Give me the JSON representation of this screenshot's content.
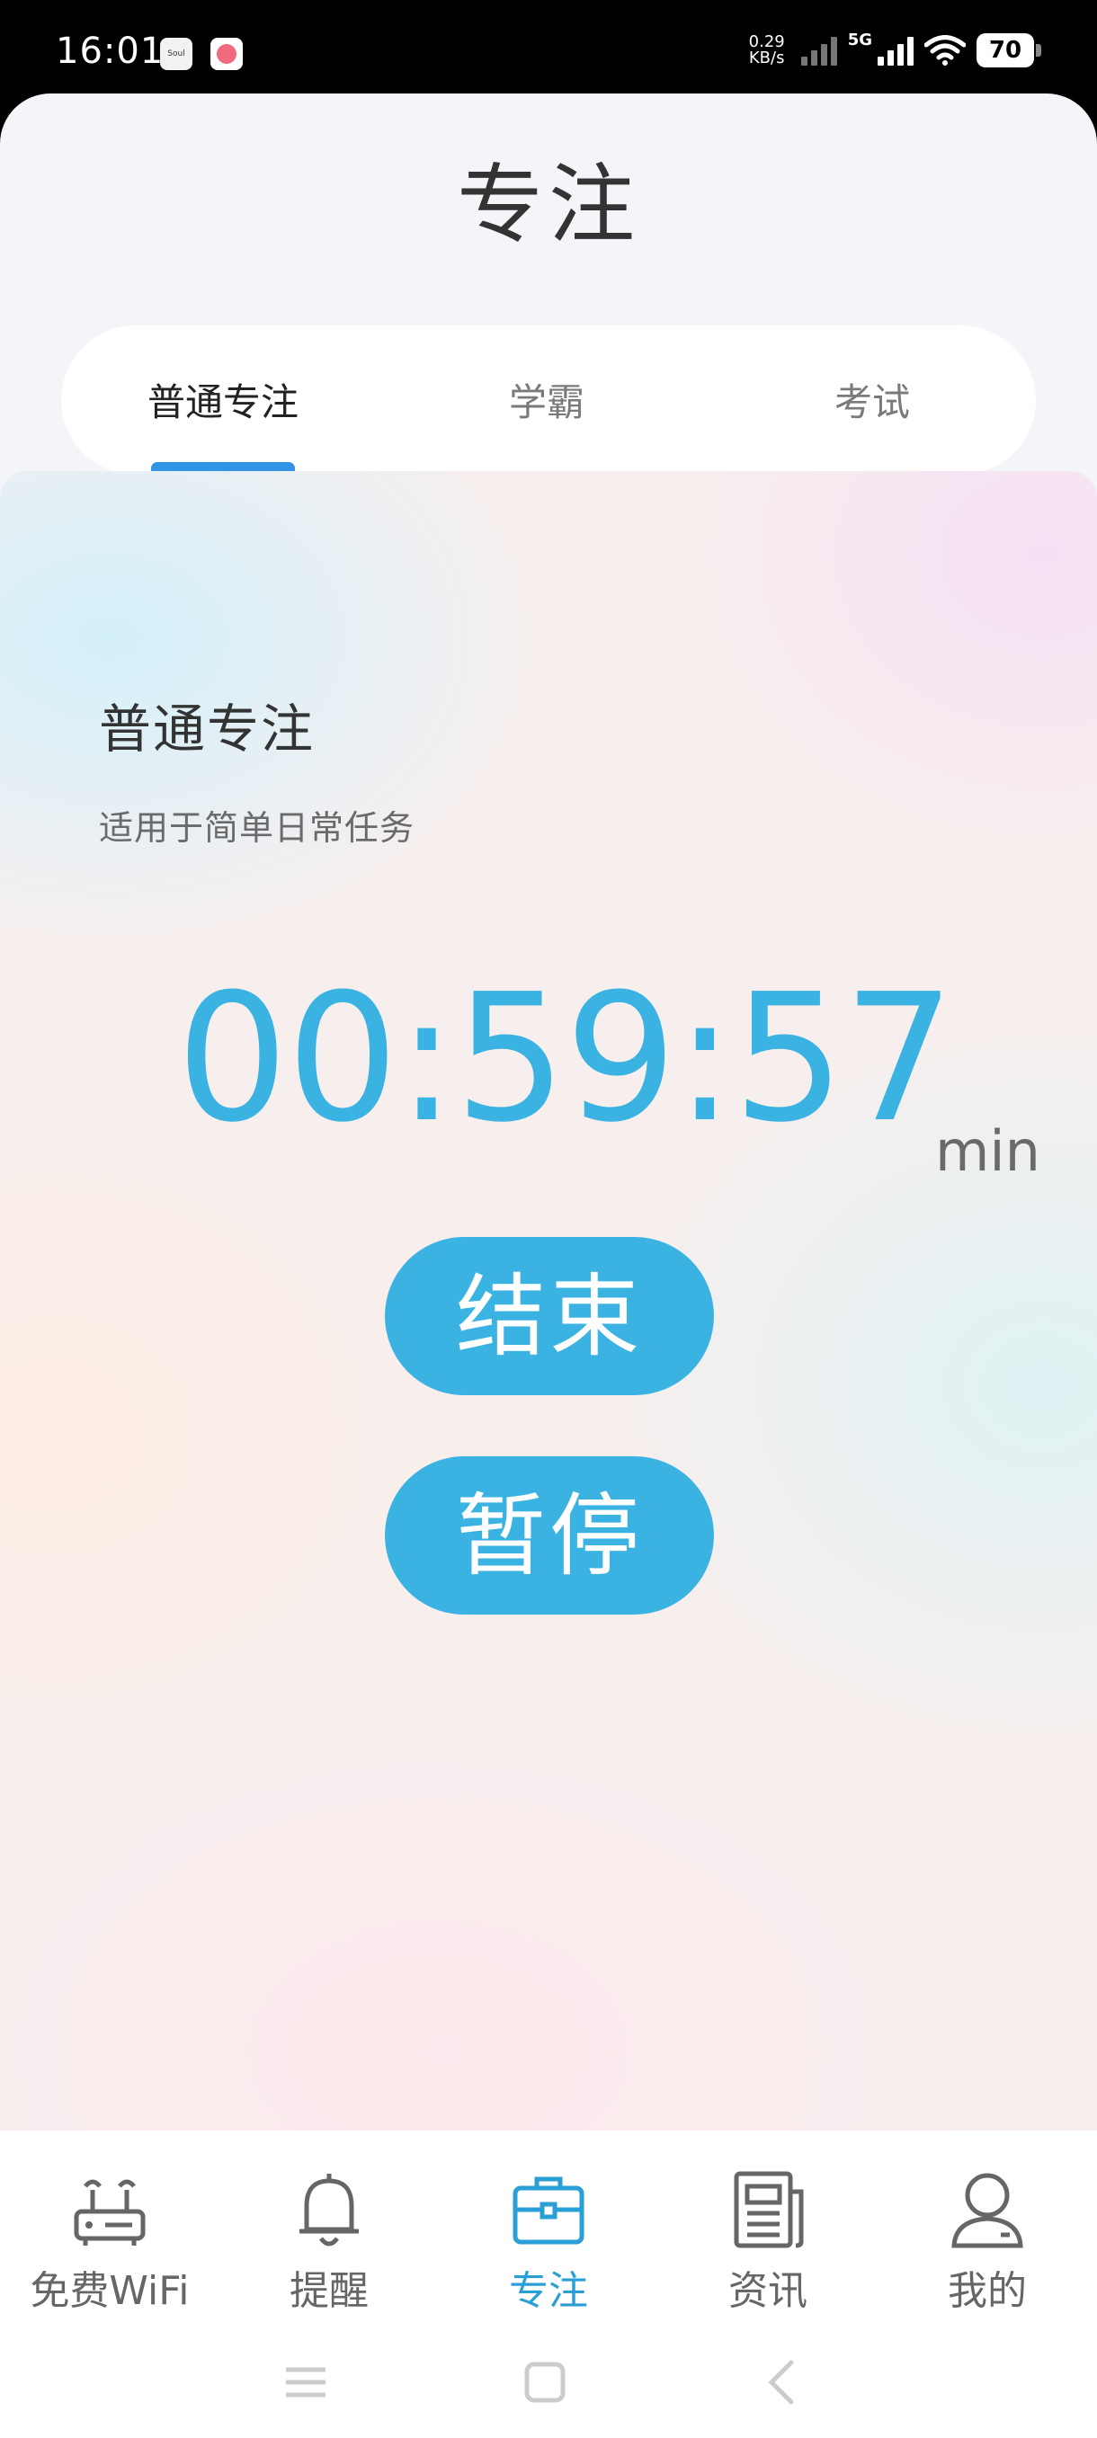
{
  "status_bar": {
    "time": "16:01",
    "app_icons": [
      "Soul",
      "heart-app"
    ],
    "speed_value": "0.29",
    "speed_unit": "KB/s",
    "network": "5G",
    "battery": "70"
  },
  "header": {
    "title": "专注"
  },
  "tabs": [
    {
      "label": "普通专注",
      "active": true
    },
    {
      "label": "学霸",
      "active": false
    },
    {
      "label": "考试",
      "active": false
    }
  ],
  "focus": {
    "mode_title": "普通专注",
    "mode_desc": "适用于简单日常任务",
    "timer": "00:59:57",
    "unit": "min",
    "end_label": "结束",
    "pause_label": "暂停"
  },
  "bottom_nav": [
    {
      "label": "免费WiFi",
      "icon": "router-icon",
      "active": false
    },
    {
      "label": "提醒",
      "icon": "bell-icon",
      "active": false
    },
    {
      "label": "专注",
      "icon": "briefcase-icon",
      "active": true
    },
    {
      "label": "资讯",
      "icon": "newspaper-icon",
      "active": false
    },
    {
      "label": "我的",
      "icon": "person-icon",
      "active": false
    }
  ],
  "colors": {
    "accent": "#3ab3e3",
    "nav_active": "#2a9fd6",
    "tab_indicator": "#2f93e6"
  }
}
